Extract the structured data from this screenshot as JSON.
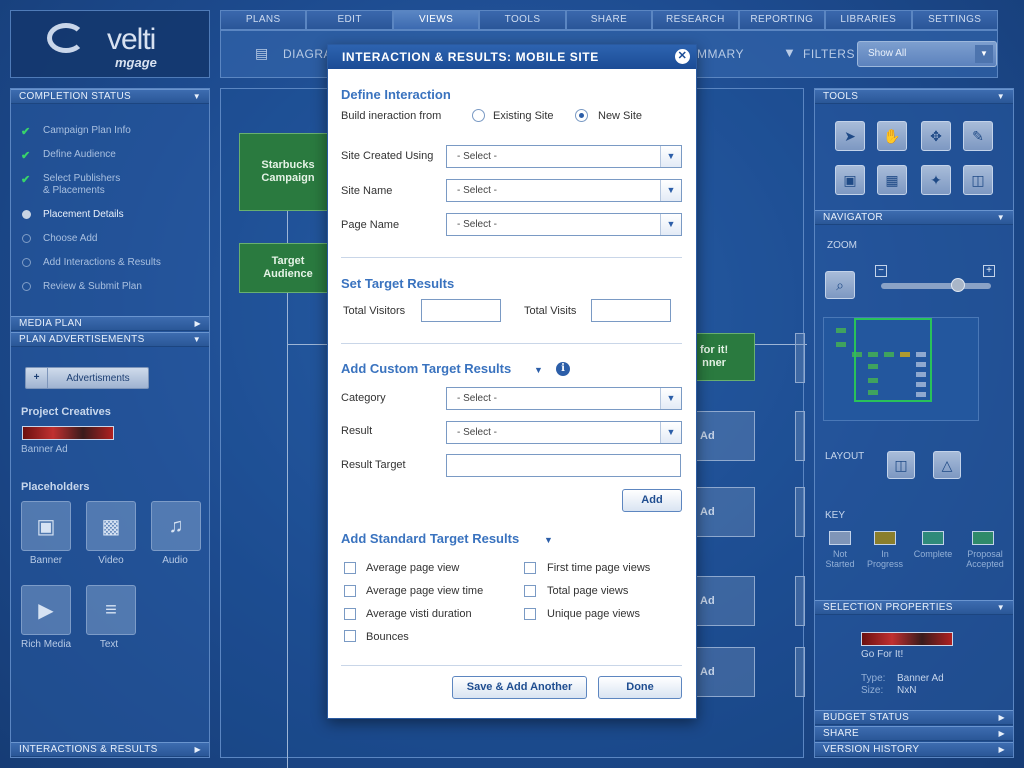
{
  "brand": {
    "logo_main": "velti",
    "logo_sub": "mgage"
  },
  "top_tabs": [
    "PLANS",
    "EDIT",
    "VIEWS",
    "TOOLS",
    "SHARE",
    "RESEARCH",
    "REPORTING",
    "LIBRARIES",
    "SETTINGS"
  ],
  "subbar": {
    "diagram": "DIAGRA",
    "summary": "MMARY",
    "filters": "FILTERS",
    "show_all": "Show All"
  },
  "left": {
    "completion_header": "COMPLETION STATUS",
    "steps": [
      {
        "label": "Campaign Plan Info",
        "state": "done"
      },
      {
        "label": "Define Audience",
        "state": "done"
      },
      {
        "label": "Select Publishers\n& Placements",
        "state": "done"
      },
      {
        "label": "Placement Details",
        "state": "current"
      },
      {
        "label": "Choose Add",
        "state": "todo"
      },
      {
        "label": "Add Interactions & Results",
        "state": "todo"
      },
      {
        "label": "Review & Submit Plan",
        "state": "todo"
      }
    ],
    "media_plan": "MEDIA PLAN",
    "plan_ads": "PLAN ADVERTISEMENTS",
    "ads_button": "Advertisments",
    "project_creatives": "Project Creatives",
    "banner_ad": "Banner Ad",
    "placeholders": "Placeholders",
    "placeholder_items": [
      "Banner",
      "Video",
      "Audio",
      "Rich Media",
      "Text"
    ],
    "interactions": "INTERACTIONS & RESULTS"
  },
  "canvas": {
    "nodes": [
      "Starbucks\nCampaign",
      "Target\nAudience",
      "for it!\nnner",
      "Ad",
      "Ad",
      "Ad",
      "Ad"
    ]
  },
  "right": {
    "tools": "TOOLS",
    "navigator": "NAVIGATOR",
    "zoom": "ZOOM",
    "layout": "LAYOUT",
    "key": "KEY",
    "key_items": [
      "Not\nStarted",
      "In\nProgress",
      "Complete",
      "Proposal\nAccepted"
    ],
    "key_colors": [
      "#7f95b8",
      "#8a7e2c",
      "#2f8a7a",
      "#2f8a6a"
    ],
    "selection_props": "SELECTION PROPERTIES",
    "go_for_it": "Go For It!",
    "type_label": "Type:",
    "type_value": "Banner Ad",
    "size_label": "Size:",
    "size_value": "NxN",
    "budget": "BUDGET STATUS",
    "share": "SHARE",
    "version": "VERSION HISTORY"
  },
  "dialog": {
    "title": "INTERACTION & RESULTS: MOBILE SITE",
    "define_interaction": "Define Interaction",
    "build_from": "Build ineraction from",
    "existing_site": "Existing Site",
    "new_site": "New Site",
    "site_created_using": "Site Created Using",
    "site_name": "Site Name",
    "page_name": "Page Name",
    "select": "- Select -",
    "set_target": "Set Target Results",
    "total_visitors": "Total Visitors",
    "total_visits": "Total Visits",
    "add_custom": "Add Custom Target Results",
    "category": "Category",
    "result": "Result",
    "result_target": "Result Target",
    "add": "Add",
    "add_standard": "Add Standard Target Results",
    "checks_left": [
      "Average page view",
      "Average page view time",
      "Average visti duration",
      "Bounces"
    ],
    "checks_right": [
      "First time page views",
      "Total page views",
      "Unique page views"
    ],
    "save_add": "Save & Add Another",
    "done": "Done"
  }
}
